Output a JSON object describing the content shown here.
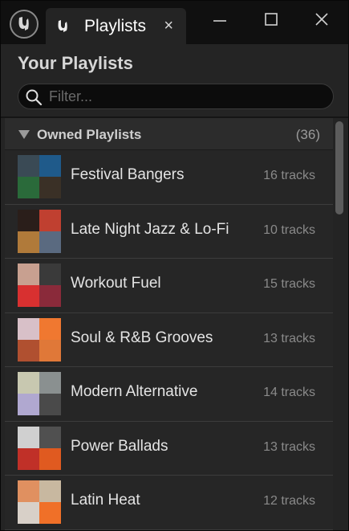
{
  "window": {
    "tab_title": "Playlists",
    "tab_close": "×"
  },
  "panel": {
    "title": "Your Playlists"
  },
  "search": {
    "placeholder": "Filter...",
    "value": ""
  },
  "section": {
    "label": "Owned Playlists",
    "count": "(36)",
    "expanded": true
  },
  "playlists": [
    {
      "name": "Festival Bangers",
      "tracks": "16 tracks",
      "cover_colors": [
        "#3a4a55",
        "#1f5a8a",
        "#2a6a3a",
        "#3a3026"
      ]
    },
    {
      "name": "Late Night Jazz & Lo-Fi",
      "tracks": "10 tracks",
      "cover_colors": [
        "#2a1e1a",
        "#c04030",
        "#b07a3a",
        "#5a6a80"
      ]
    },
    {
      "name": "Workout Fuel",
      "tracks": "15 tracks",
      "cover_colors": [
        "#c8a090",
        "#3a3a3a",
        "#d83030",
        "#8a2a3a"
      ]
    },
    {
      "name": "Soul & R&B Grooves",
      "tracks": "13 tracks",
      "cover_colors": [
        "#d8c0c8",
        "#f07830",
        "#b05030",
        "#e07838"
      ]
    },
    {
      "name": "Modern Alternative",
      "tracks": "14 tracks",
      "cover_colors": [
        "#c8c8b0",
        "#8a9090",
        "#b0a8d0",
        "#4a4a4a"
      ]
    },
    {
      "name": "Power Ballads",
      "tracks": "13 tracks",
      "cover_colors": [
        "#d0d0d0",
        "#505050",
        "#c03028",
        "#e05a20"
      ]
    },
    {
      "name": "Latin Heat",
      "tracks": "12 tracks",
      "cover_colors": [
        "#e09060",
        "#c8b8a0",
        "#d8d0c8",
        "#f07028"
      ]
    }
  ],
  "colors": {
    "background": "#242424",
    "titlebar": "#101010",
    "accent_text": "#ffffff",
    "muted_text": "#8a8a8a"
  }
}
